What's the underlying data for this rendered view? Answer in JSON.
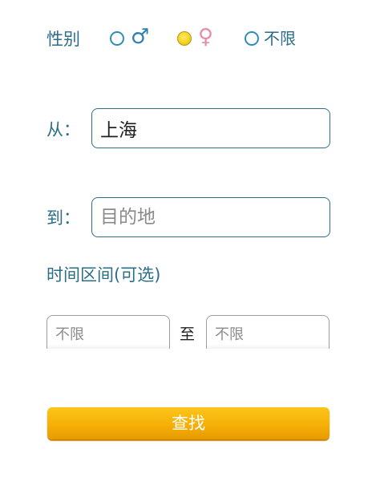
{
  "gender": {
    "label": "性别",
    "options": [
      {
        "symbol": "♂",
        "text": "",
        "selected": false
      },
      {
        "symbol": "♀",
        "text": "",
        "selected": true
      },
      {
        "symbol": "",
        "text": "不限",
        "selected": false
      }
    ]
  },
  "from": {
    "label": "从：",
    "value": "上海",
    "placeholder": ""
  },
  "to": {
    "label": "到：",
    "value": "",
    "placeholder": "目的地"
  },
  "time_range": {
    "label": "时间区间(可选)",
    "start_placeholder": "不限",
    "separator": "至",
    "end_placeholder": "不限"
  },
  "search_button": {
    "label": "查找"
  },
  "colors": {
    "label_text": "#2a6e88",
    "button": "#f6b007",
    "radio_selected": "#f7d21e",
    "male_symbol": "#2f7fb0",
    "female_symbol": "#e48ea4"
  }
}
